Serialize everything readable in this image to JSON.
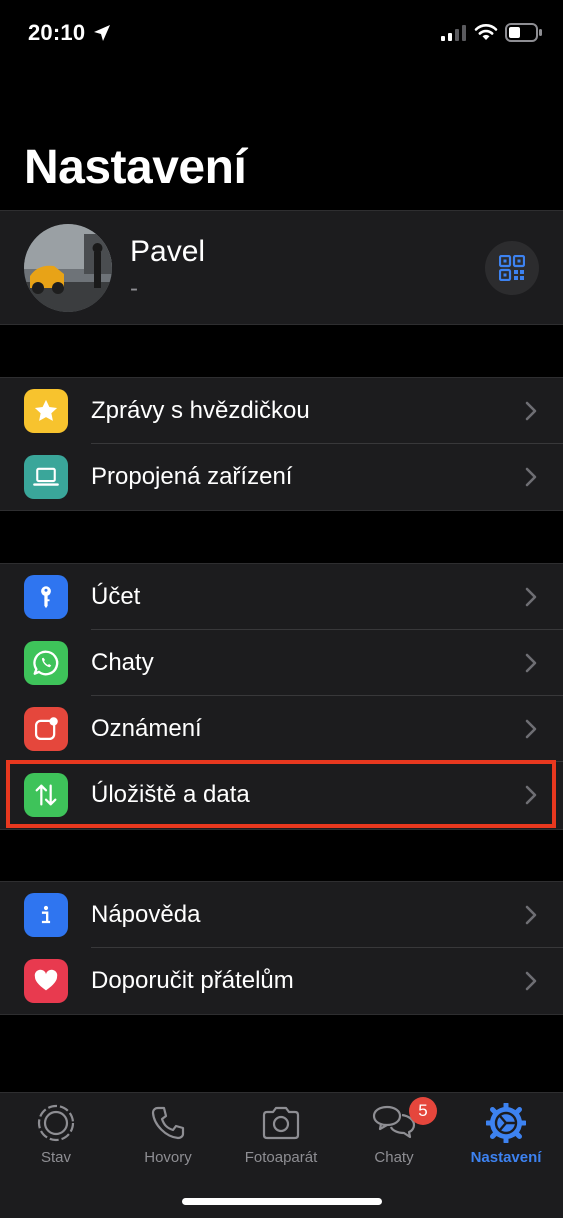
{
  "status_bar": {
    "time": "20:10"
  },
  "title": "Nastavení",
  "profile": {
    "name": "Pavel",
    "status": "-"
  },
  "group1": [
    {
      "label": "Zprávy s hvězdičkou",
      "icon": "star-icon",
      "color": "#f7c32e"
    },
    {
      "label": "Propojená zařízení",
      "icon": "laptop-icon",
      "color": "#3aa69a"
    }
  ],
  "group2": [
    {
      "label": "Účet",
      "icon": "key-icon",
      "color": "#2f75f0"
    },
    {
      "label": "Chaty",
      "icon": "whatsapp-icon",
      "color": "#3ec35a"
    },
    {
      "label": "Oznámení",
      "icon": "notification-icon",
      "color": "#e5473c"
    },
    {
      "label": "Úložiště a data",
      "icon": "arrows-updown-icon",
      "color": "#3ec35a"
    }
  ],
  "group3": [
    {
      "label": "Nápověda",
      "icon": "info-icon",
      "color": "#2f75f0"
    },
    {
      "label": "Doporučit přátelům",
      "icon": "heart-icon",
      "color": "#e83a4f"
    }
  ],
  "tabs": [
    {
      "label": "Stav",
      "icon": "status-icon"
    },
    {
      "label": "Hovory",
      "icon": "phone-icon"
    },
    {
      "label": "Fotoaparát",
      "icon": "camera-icon"
    },
    {
      "label": "Chaty",
      "icon": "chats-icon",
      "badge": "5"
    },
    {
      "label": "Nastavení",
      "icon": "settings-icon",
      "active": true
    }
  ],
  "colors": {
    "accent": "#3d82f0",
    "highlight": "#e8381f",
    "badge": "#e5463c"
  }
}
